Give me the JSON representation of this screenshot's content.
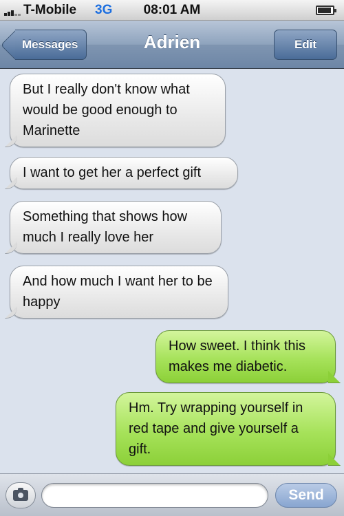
{
  "status_bar": {
    "carrier": "T-Mobile",
    "network": "3G",
    "time": "08:01 AM",
    "signal_icon": "signal-bars-icon",
    "battery_icon": "battery-icon",
    "battery_level": 0.9
  },
  "nav": {
    "back_label": "Messages",
    "title": "Adrien",
    "edit_label": "Edit"
  },
  "messages": [
    {
      "direction": "received",
      "text": "But I really don't know what would be good enough to Marinette"
    },
    {
      "direction": "received",
      "text": "I want to get her a perfect gift"
    },
    {
      "direction": "received",
      "text": "Something that shows how much I really love her"
    },
    {
      "direction": "received",
      "text": "And how much I want her to be happy"
    },
    {
      "direction": "sent",
      "text": "How sweet. I think this makes me diabetic."
    },
    {
      "direction": "sent",
      "text": "Hm.  Try wrapping yourself in red tape and give yourself a gift."
    }
  ],
  "input_bar": {
    "camera_icon": "camera-icon",
    "input_value": "",
    "input_placeholder": "",
    "send_label": "Send"
  },
  "colors": {
    "sent_bubble": "#a6e25a",
    "received_bubble": "#e9e9e9",
    "nav_bar": "#7f95b1",
    "background": "#dbe2ed"
  }
}
